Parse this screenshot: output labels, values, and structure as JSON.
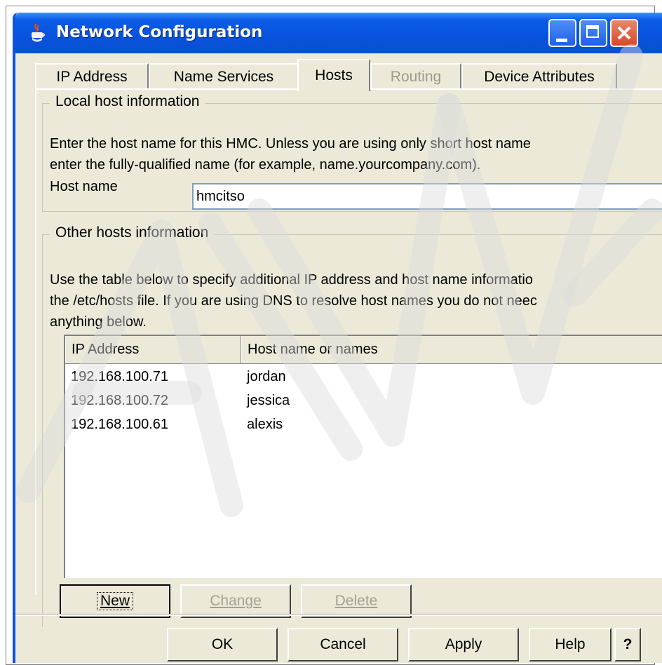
{
  "window": {
    "title": "Network Configuration",
    "controls": [
      "minimize-icon",
      "maximize-icon",
      "close-icon"
    ]
  },
  "tabs": [
    {
      "label": "IP Address",
      "state": "normal"
    },
    {
      "label": "Name Services",
      "state": "normal"
    },
    {
      "label": "Hosts",
      "state": "selected"
    },
    {
      "label": "Routing",
      "state": "disabled"
    },
    {
      "label": "Device Attributes",
      "state": "normal"
    }
  ],
  "local": {
    "legend": "Local host information",
    "desc_line1": "Enter the host name for this HMC.  Unless you are using only short host name",
    "desc_line2": "enter the fully-qualified name (for example, name.yourcompany.com).",
    "hostname_label": "Host name",
    "hostname_value": "hmcitso"
  },
  "other": {
    "legend": "Other hosts information",
    "desc_line1": "Use the table below to specify additional IP address and host name informatio",
    "desc_line2": "the /etc/hosts file.  If you are using DNS to resolve host names you do not neec",
    "desc_line3": "anything below.",
    "columns": [
      "IP Address",
      "Host name or names"
    ],
    "rows": [
      {
        "ip": "192.168.100.71",
        "host": "jordan"
      },
      {
        "ip": "192.168.100.72",
        "host": "jessica"
      },
      {
        "ip": "192.168.100.61",
        "host": "alexis"
      }
    ],
    "buttons": {
      "new": "New",
      "change": "Change",
      "delete": "Delete"
    }
  },
  "dialog_buttons": {
    "ok": "OK",
    "cancel": "Cancel",
    "apply": "Apply",
    "help": "Help",
    "question": "?"
  },
  "colors": {
    "titlebar": "#0753dd",
    "dialog_bg": "#ece9d8",
    "input_border": "#7f9db9"
  }
}
